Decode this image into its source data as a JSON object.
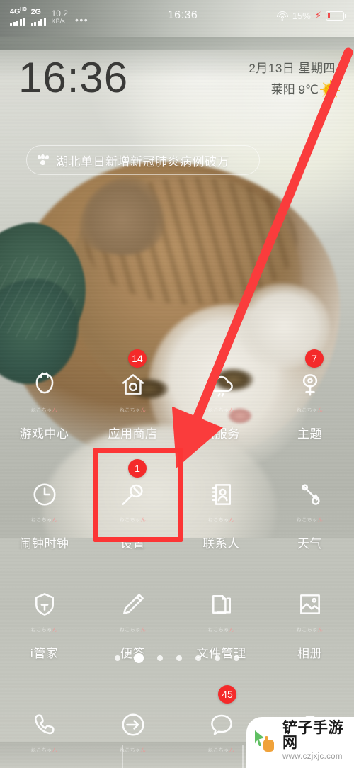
{
  "statusbar": {
    "network_primary": "4G",
    "network_primary_sup": "HD",
    "network_secondary": "2G",
    "netspeed_value": "10.2",
    "netspeed_unit": "KB/s",
    "overflow_dots": "•••",
    "time": "16:36",
    "battery_percent": "15%",
    "charging_bolt": "⚡",
    "wifi_icon": "wifi-icon",
    "battery_icon": "battery-icon"
  },
  "lockinfo": {
    "clock": "16:36",
    "date": "2月13日 星期四",
    "weather_text": "莱阳 9℃",
    "weather_icon": "sun-icon"
  },
  "news": {
    "icon": "baidu-paw-icon",
    "headline": "湖北单日新增新冠肺炎病例破万"
  },
  "apps": [
    [
      {
        "label": "游戏中心",
        "icon": "game-center-icon",
        "sub": "ねこちゃん",
        "badge": null
      },
      {
        "label": "应用商店",
        "icon": "app-store-icon",
        "sub": "ねこちゃん",
        "badge": "14"
      },
      {
        "label": "云服务",
        "icon": "cloud-service-icon",
        "sub": "ねこちゃん",
        "badge": null
      },
      {
        "label": "主题",
        "icon": "theme-icon",
        "sub": "ねこちゃん",
        "badge": "7"
      }
    ],
    [
      {
        "label": "闹钟时钟",
        "icon": "clock-icon",
        "sub": "ねこちゃん",
        "badge": null
      },
      {
        "label": "设置",
        "icon": "settings-wrench-icon",
        "sub": "ねこちゃん",
        "badge": "1"
      },
      {
        "label": "联系人",
        "icon": "contacts-icon",
        "sub": "ねこちゃん",
        "badge": null
      },
      {
        "label": "天气",
        "icon": "weather-icon",
        "sub": "ねこちゃん",
        "badge": null
      }
    ],
    [
      {
        "label": "i管家",
        "icon": "shield-manager-icon",
        "sub": "ねこちゃん",
        "badge": null
      },
      {
        "label": "便签",
        "icon": "notes-pencil-icon",
        "sub": "ねこちゃん",
        "badge": null
      },
      {
        "label": "文件管理",
        "icon": "file-manager-icon",
        "sub": "ねこちゃん",
        "badge": null
      },
      {
        "label": "相册",
        "icon": "gallery-icon",
        "sub": "ねこちゃん",
        "badge": null
      }
    ]
  ],
  "pager": {
    "count": 7,
    "active_index": 1
  },
  "dock": [
    {
      "label": "",
      "icon": "phone-icon",
      "sub": "ねこちゃん",
      "badge": null
    },
    {
      "label": "",
      "icon": "browser-icon",
      "sub": "ねこちゃん",
      "badge": null
    },
    {
      "label": "",
      "icon": "messages-icon",
      "sub": "ねこちゃん",
      "badge": "45"
    },
    {
      "label": "",
      "icon": "camera-icon",
      "sub": "",
      "badge": null
    }
  ],
  "annotation": {
    "arrow_color": "#fa3c3c",
    "box_color": "#fc3535",
    "highlight_target": "设置"
  },
  "watermark": {
    "title": "铲子手游网",
    "url": "www.czjxjc.com",
    "logo": "cursor-hand-logo"
  },
  "colors": {
    "badge_red": "#f42a2a",
    "annotation_red": "#fa3c3c",
    "status_text": "#ffffff",
    "clock_text": "#3a3a38",
    "date_text": "#585b56"
  }
}
